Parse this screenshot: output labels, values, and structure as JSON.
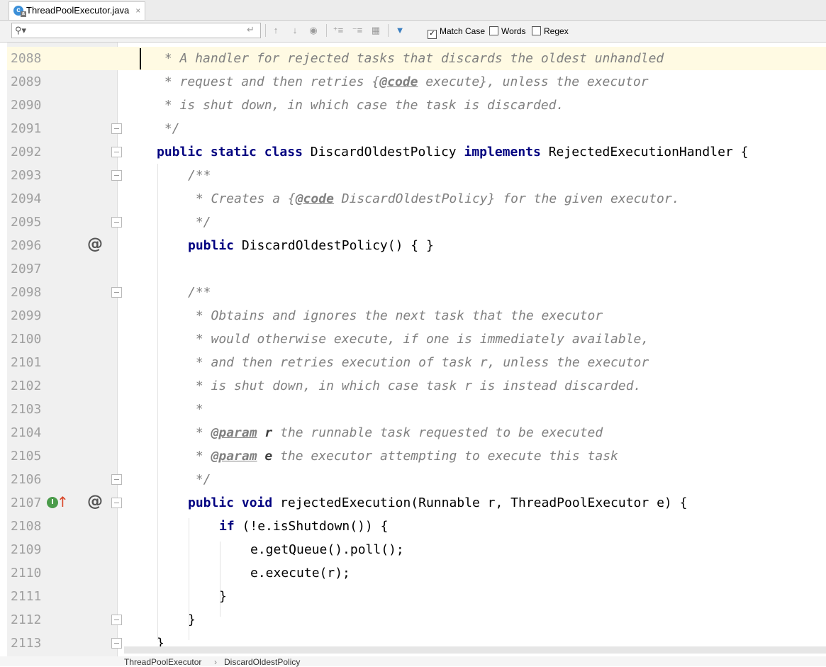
{
  "tab": {
    "filename": "ThreadPoolExecutor.java",
    "file_icon": "java-class-icon",
    "close": "×"
  },
  "search": {
    "value": "",
    "placeholder": "",
    "options": [
      {
        "label": "Match Case",
        "checked": true
      },
      {
        "label": "Words",
        "checked": false
      },
      {
        "label": "Regex",
        "checked": false
      }
    ]
  },
  "editor": {
    "line_numbers": [
      "2088",
      "2089",
      "2090",
      "2091",
      "2092",
      "2093",
      "2094",
      "2095",
      "2096",
      "2097",
      "2098",
      "2099",
      "2100",
      "2101",
      "2102",
      "2103",
      "2104",
      "2105",
      "2106",
      "2107",
      "2108",
      "2109",
      "2110",
      "2111",
      "2112",
      "2113"
    ],
    "current_line": "2088",
    "gutter_annotations": {
      "2096": "@",
      "2107": "@"
    },
    "code": {
      "l2088": " * A handler for rejected tasks that discards the oldest unhandled",
      "l2089_a": " * request and then retries ",
      "l2089_tag": "@code",
      "l2089_b": " execute}, unless the executor",
      "l2090": " * is shut down, in which case the task is discarded.",
      "l2091": " */",
      "l2092_kw": "public static class",
      "l2092_name": " DiscardOldestPolicy ",
      "l2092_kw2": "implements",
      "l2092_rest": " RejectedExecutionHandler {",
      "l2093": "/**",
      "l2094_a": " * Creates a {",
      "l2094_tag": "@code",
      "l2094_b": " DiscardOldestPolicy} for the given executor.",
      "l2095": " */",
      "l2096_kw": "public",
      "l2096_rest": " DiscardOldestPolicy() { }",
      "l2098": "/**",
      "l2099": " * Obtains and ignores the next task that the executor",
      "l2100": " * would otherwise execute, if one is immediately available,",
      "l2101": " * and then retries execution of task r, unless the executor",
      "l2102": " * is shut down, in which case task r is instead discarded.",
      "l2103": " *",
      "l2104_a": " * ",
      "l2104_tag": "@param",
      "l2104_p": " r",
      "l2104_b": " the runnable task requested to be executed",
      "l2105_a": " * ",
      "l2105_tag": "@param",
      "l2105_p": " e",
      "l2105_b": " the executor attempting to execute this task",
      "l2106": " */",
      "l2107_kw": "public void",
      "l2107_rest": " rejectedExecution(Runnable r, ThreadPoolExecutor e) {",
      "l2108_kw": "if",
      "l2108_rest": " (!e.isShutdown()) {",
      "l2109": "e.getQueue().poll();",
      "l2110": "e.execute(r);",
      "l2111": "}",
      "l2112": "}",
      "l2113": "}"
    }
  },
  "breadcrumb": {
    "items": [
      "ThreadPoolExecutor",
      "DiscardOldestPolicy"
    ],
    "separator": "›"
  }
}
